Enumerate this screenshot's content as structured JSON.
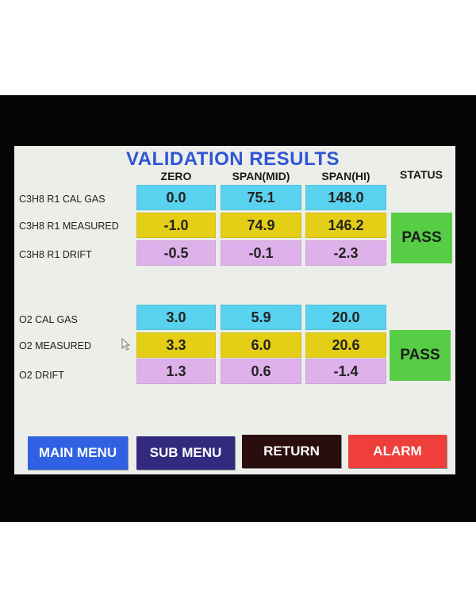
{
  "title": "VALIDATION RESULTS",
  "columns": {
    "zero": "ZERO",
    "span_mid": "SPAN(MID)",
    "span_hi": "SPAN(HI)",
    "status": "STATUS"
  },
  "c3h8": {
    "rows": [
      {
        "label": "C3H8 R1 CAL GAS",
        "zero": "0.0",
        "span_mid": "75.1",
        "span_hi": "148.0"
      },
      {
        "label": "C3H8 R1 MEASURED",
        "zero": "-1.0",
        "span_mid": "74.9",
        "span_hi": "146.2"
      },
      {
        "label": "C3H8 R1 DRIFT",
        "zero": "-0.5",
        "span_mid": "-0.1",
        "span_hi": "-2.3"
      }
    ],
    "status": "PASS"
  },
  "o2": {
    "rows": [
      {
        "label": "O2 CAL GAS",
        "zero": "3.0",
        "span_mid": "5.9",
        "span_hi": "20.0"
      },
      {
        "label": "O2 MEASURED",
        "zero": "3.3",
        "span_mid": "6.0",
        "span_hi": "20.6"
      },
      {
        "label": "O2 DRIFT",
        "zero": "1.3",
        "span_mid": "0.6",
        "span_hi": "-1.4"
      }
    ],
    "status": "PASS"
  },
  "nav": {
    "main_menu": "MAIN MENU",
    "sub_menu": "SUB MENU",
    "return": "RETURN",
    "alarm": "ALARM"
  },
  "colors": {
    "title": "#2f55d6",
    "cal_gas_cell": "#58d2ee",
    "measured_cell": "#e4cf16",
    "drift_cell": "#dfb1ea",
    "pass_status": "#56cd45",
    "main_menu_button": "#2f61e2",
    "sub_menu_button": "#332a80",
    "return_button": "#2a0d0d",
    "alarm_button": "#ef3f3a"
  },
  "icons": {
    "cursor": "mouse-pointer-icon"
  }
}
